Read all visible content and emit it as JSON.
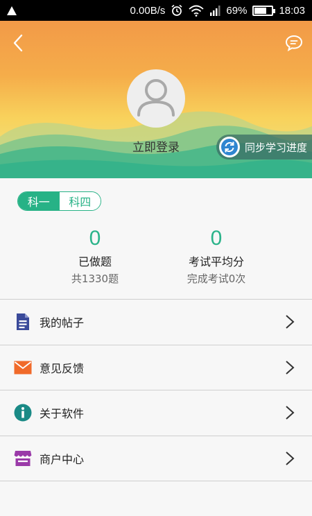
{
  "status_bar": {
    "speed": "0.00B/s",
    "battery": "69%",
    "battery_level": 0.69,
    "time": "18:03",
    "icons": [
      "warning-icon",
      "alarm-icon",
      "wifi-icon",
      "signal-icon",
      "battery-icon"
    ]
  },
  "header": {
    "back_icon": "chevron-left-icon",
    "message_icon": "message-icon",
    "login_label": "立即登录",
    "sync_label": "同步学习进度",
    "colors": {
      "top": "#f29a48",
      "bottom": "#f0e08a",
      "hills": "#36b38a"
    }
  },
  "subject_tabs": [
    {
      "label": "科一",
      "active": true
    },
    {
      "label": "科四",
      "active": false
    }
  ],
  "stats": {
    "done": {
      "value": "0",
      "label": "已做题",
      "sub": "共1330题"
    },
    "average": {
      "value": "0",
      "label": "考试平均分",
      "sub": "完成考试0次"
    }
  },
  "menu": [
    {
      "label": "我的帖子",
      "icon": "document-icon",
      "color": "#3a4a9a"
    },
    {
      "label": "意见反馈",
      "icon": "mail-icon",
      "color": "#f06a2a"
    },
    {
      "label": "关于软件",
      "icon": "info-icon",
      "color": "#1a8a86"
    },
    {
      "label": "商户中心",
      "icon": "store-icon",
      "color": "#9a3aa8"
    }
  ],
  "accent_color": "#27b286"
}
